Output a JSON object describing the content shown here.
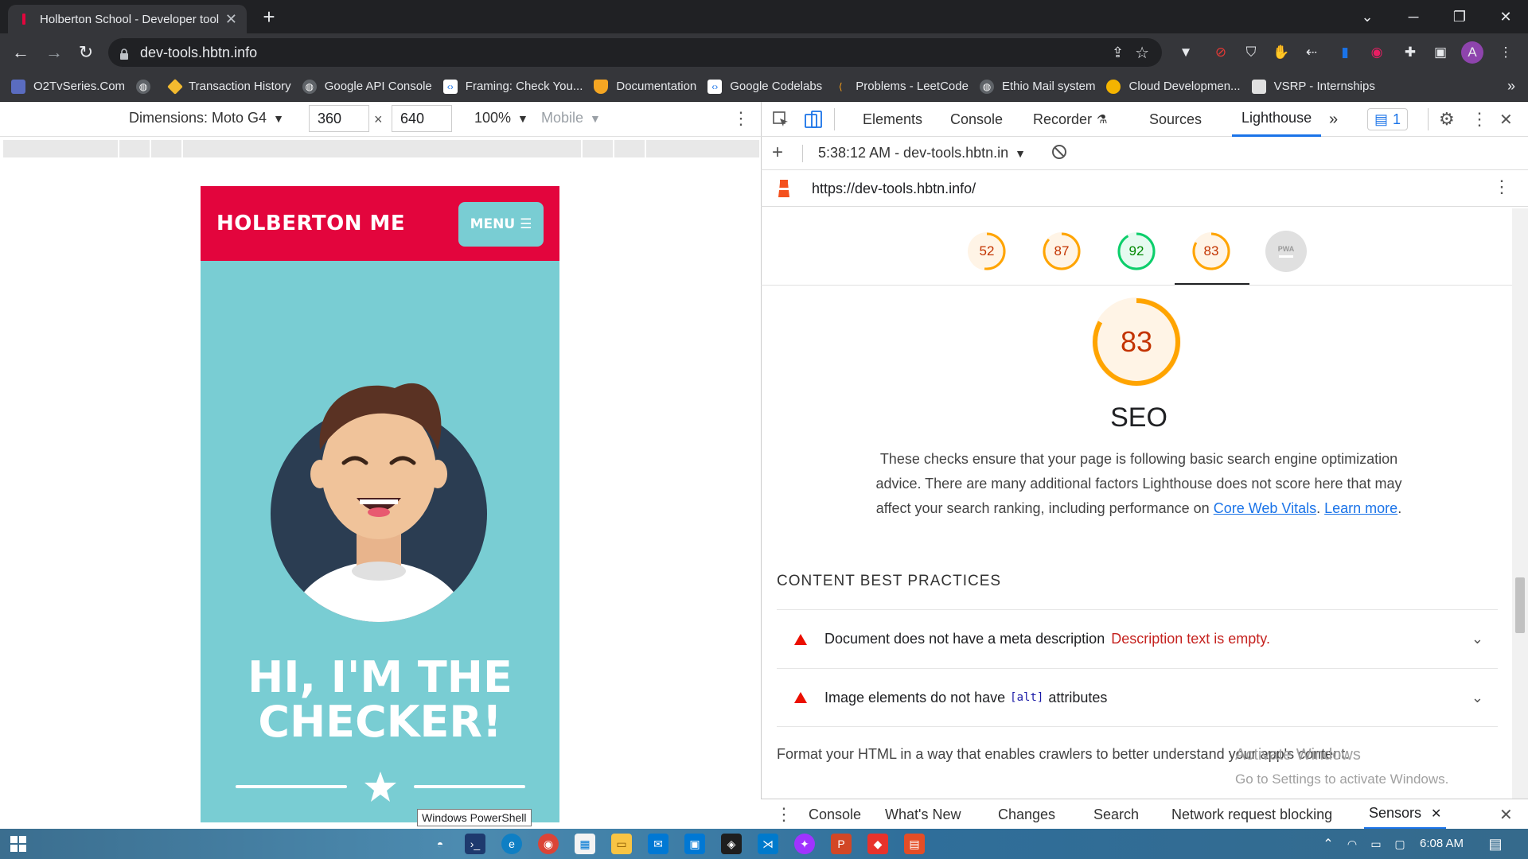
{
  "browser": {
    "tab_title": "Holberton School - Developer tools",
    "new_tab": "+",
    "close_tab": "✕",
    "url": "dev-tools.hbtn.info",
    "profile_initial": "A"
  },
  "bookmarks": [
    {
      "label": "O2TvSeries.Com",
      "color": "#5a6cc0"
    },
    {
      "label": "",
      "color": "#5f6368"
    },
    {
      "label": "Transaction History",
      "color": "#f3ba2f"
    },
    {
      "label": "Google API Console",
      "color": "#5f6368"
    },
    {
      "label": "Framing: Check You...",
      "color": "#ffffff"
    },
    {
      "label": "Documentation",
      "color": "#f5a623"
    },
    {
      "label": "Google Codelabs",
      "color": "#ffffff"
    },
    {
      "label": "Problems - LeetCode",
      "color": "#ffa116"
    },
    {
      "label": "Ethio Mail system",
      "color": "#5f6368"
    },
    {
      "label": "Cloud Developmen...",
      "color": "#f4b400"
    },
    {
      "label": "VSRP - Internships",
      "color": "#e0e0e0"
    }
  ],
  "bookmarks_overflow": "»",
  "device_toolbar": {
    "dimensions_label": "Dimensions: Moto G4",
    "width": "360",
    "times": "×",
    "height": "640",
    "zoom": "100%",
    "throttle": "Mobile"
  },
  "emulated_page": {
    "brand": "HOLBERTON ME",
    "menu_button": "MENU ☰",
    "hero_title_line1": "HI, I'M THE",
    "hero_title_line2": "CHECKER!"
  },
  "devtools": {
    "tabs": [
      "Elements",
      "Console",
      "Recorder",
      "Sources",
      "Lighthouse"
    ],
    "active_tab": "Lighthouse",
    "overflow": "»",
    "issues_count": "1",
    "report_label": "5:38:12 AM - dev-tools.hbtn.in",
    "report_url": "https://dev-tools.hbtn.info/",
    "scores": [
      {
        "value": "52",
        "color": "#fa3",
        "text_color": "#c33300"
      },
      {
        "value": "87",
        "color": "#fa3",
        "text_color": "#c33300"
      },
      {
        "value": "92",
        "color": "#0c6",
        "text_color": "#008800"
      },
      {
        "value": "83",
        "color": "#fa3",
        "text_color": "#c33300"
      }
    ],
    "pwa_label": "PWA",
    "main_score": "83",
    "category_title": "SEO",
    "description": "These checks ensure that your page is following basic search engine optimization advice. There are many additional factors Lighthouse does not score here that may affect your search ranking, including performance on",
    "link_core_web_vitals": "Core Web Vitals",
    "link_learn_more": "Learn more",
    "section_title": "CONTENT BEST PRACTICES",
    "audits": [
      {
        "title": "Document does not have a meta description",
        "detail": "Description text is empty."
      },
      {
        "title_before": "Image elements do not have",
        "code": "[alt]",
        "title_after": "attributes"
      }
    ],
    "format_text": "Format your HTML in a way that enables crawlers to better understand your app's content.",
    "activate_windows": "Activate Windows",
    "activate_windows_sub": "Go to Settings to activate Windows."
  },
  "drawer": {
    "tabs": [
      "Console",
      "What's New",
      "Changes",
      "Search",
      "Network request blocking",
      "Sensors"
    ],
    "active": "Sensors"
  },
  "tooltip": "Windows PowerShell",
  "taskbar": {
    "time": "6:08 AM"
  },
  "colors": {
    "header_red": "#e3053d",
    "teal": "#79cdd3",
    "score_orange": "#ffa400",
    "score_green": "#0cce6b",
    "fail_red": "#eb0f00",
    "link_blue": "#1a73e8"
  }
}
